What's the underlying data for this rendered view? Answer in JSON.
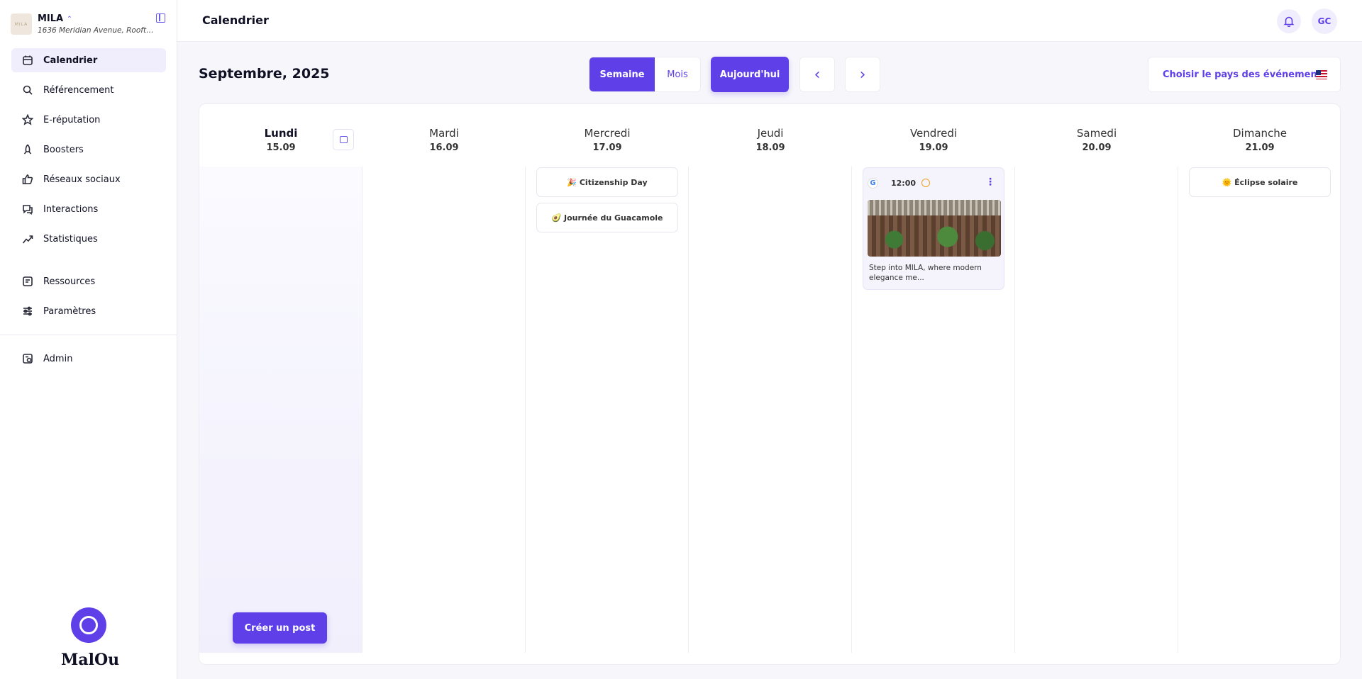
{
  "brand": {
    "name": "MILA",
    "address": "1636 Meridian Avenue, Rooftop...",
    "logo_text": "MILA"
  },
  "sidebar": {
    "items": [
      {
        "label": "Calendrier",
        "icon": "calendar-icon"
      },
      {
        "label": "Référencement",
        "icon": "search-icon"
      },
      {
        "label": "E-réputation",
        "icon": "star-icon"
      },
      {
        "label": "Boosters",
        "icon": "rocket-icon"
      },
      {
        "label": "Réseaux sociaux",
        "icon": "thumbs-up-icon"
      },
      {
        "label": "Interactions",
        "icon": "chat-icon"
      },
      {
        "label": "Statistiques",
        "icon": "trend-icon"
      },
      {
        "label": "Ressources",
        "icon": "resources-icon"
      },
      {
        "label": "Paramètres",
        "icon": "sliders-icon"
      },
      {
        "label": "Admin",
        "icon": "admin-icon"
      }
    ],
    "footer_word": "MalOu"
  },
  "header": {
    "title": "Calendrier",
    "avatar_initials": "GC"
  },
  "toolbar": {
    "month_title": "Septembre, 2025",
    "view_week": "Semaine",
    "view_month": "Mois",
    "today": "Aujourd'hui",
    "prev": "‹",
    "next": "›",
    "country_label": "Choisir le pays des événements"
  },
  "calendar": {
    "days": [
      {
        "name": "Lundi",
        "date": "15.09"
      },
      {
        "name": "Mardi",
        "date": "16.09"
      },
      {
        "name": "Mercredi",
        "date": "17.09"
      },
      {
        "name": "Jeudi",
        "date": "18.09"
      },
      {
        "name": "Vendredi",
        "date": "19.09"
      },
      {
        "name": "Samedi",
        "date": "20.09"
      },
      {
        "name": "Dimanche",
        "date": "21.09"
      }
    ],
    "events": {
      "wed_1": "🎉 Citizenship Day",
      "wed_2": "🥑 Journée du Guacamole",
      "sun_1": "🌞 Éclipse solaire"
    },
    "post": {
      "time": "12:00",
      "platform": "G",
      "text": "Step into MILA, where modern elegance me..."
    },
    "create_button": "Créer un post"
  },
  "colors": {
    "accent": "#5f40e8",
    "active_bg": "#f0eefc"
  }
}
